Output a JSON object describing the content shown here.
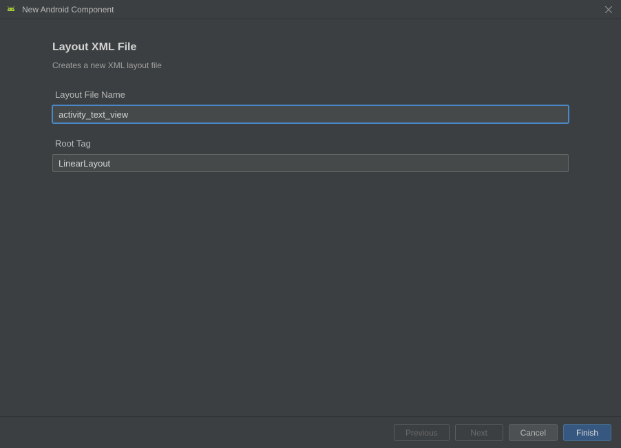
{
  "window": {
    "title": "New Android Component"
  },
  "page": {
    "title": "Layout XML File",
    "subtitle": "Creates a new XML layout file"
  },
  "fields": {
    "layoutFileName": {
      "label": "Layout File Name",
      "value": "activity_text_view"
    },
    "rootTag": {
      "label": "Root Tag",
      "value": "LinearLayout"
    }
  },
  "buttons": {
    "previous": "Previous",
    "next": "Next",
    "cancel": "Cancel",
    "finish": "Finish"
  }
}
